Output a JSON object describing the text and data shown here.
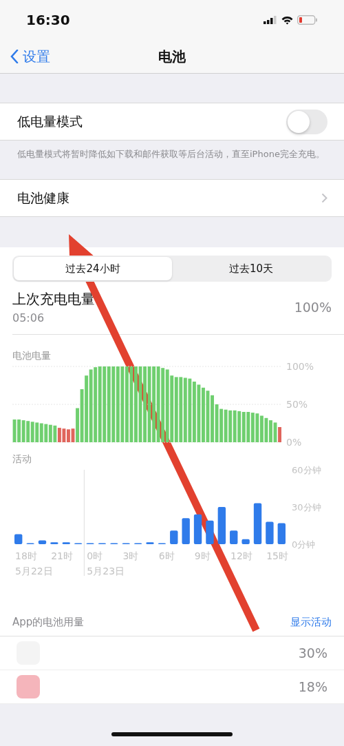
{
  "status_bar": {
    "time": "16:30"
  },
  "nav": {
    "back": "设置",
    "title": "电池"
  },
  "low_power": {
    "label": "低电量模式",
    "on": false,
    "footer": "低电量模式将暂时降低如下载和邮件获取等后台活动，直至iPhone完全充电。"
  },
  "battery_health": {
    "label": "电池健康"
  },
  "period_tabs": [
    {
      "label": "过去24小时",
      "selected": true
    },
    {
      "label": "过去10天",
      "selected": false
    }
  ],
  "last_charge": {
    "label": "上次充电电量",
    "time": "05:06",
    "value": "100%"
  },
  "battery_chart": {
    "chart_data": {
      "type": "bar",
      "title": "电池电量",
      "ylim": [
        0,
        100
      ],
      "yticks": [
        {
          "value": 0,
          "label": "0%"
        },
        {
          "value": 50,
          "label": "50%"
        },
        {
          "value": 100,
          "label": "100%"
        }
      ],
      "series": [
        {
          "color": "#6fcf6f",
          "values": [
            30,
            30,
            29,
            28,
            27,
            26,
            25,
            24,
            23,
            22,
            null,
            null,
            null,
            null,
            45,
            70,
            88,
            96,
            99,
            100,
            100,
            100,
            100,
            100,
            100,
            100,
            100,
            100,
            100,
            100,
            100,
            100,
            100,
            98,
            96,
            88,
            86,
            86,
            85,
            84,
            80,
            76,
            72,
            68,
            62,
            50,
            44,
            43,
            42,
            42,
            41,
            40,
            40,
            39,
            38,
            35,
            32,
            29,
            26,
            null
          ]
        },
        {
          "color": "#e0655c",
          "values": [
            null,
            null,
            null,
            null,
            null,
            null,
            null,
            null,
            null,
            null,
            19,
            18,
            17,
            18,
            null,
            null,
            null,
            null,
            null,
            null,
            null,
            null,
            null,
            null,
            null,
            null,
            null,
            null,
            null,
            null,
            null,
            null,
            null,
            null,
            null,
            null,
            null,
            null,
            null,
            null,
            null,
            null,
            null,
            null,
            null,
            null,
            null,
            null,
            null,
            null,
            null,
            null,
            null,
            null,
            null,
            null,
            null,
            null,
            null,
            20
          ]
        }
      ]
    }
  },
  "activity_chart": {
    "chart_data": {
      "type": "bar",
      "title": "活动",
      "ylim": [
        0,
        60
      ],
      "yticks": [
        {
          "value": 0,
          "label": "0分钟"
        },
        {
          "value": 30,
          "label": "30分钟"
        },
        {
          "value": 60,
          "label": "60分钟"
        }
      ],
      "categories": [
        "18时",
        null,
        null,
        "21时",
        null,
        null,
        "0时",
        null,
        null,
        "3时",
        null,
        null,
        "6时",
        null,
        null,
        "9时",
        null,
        null,
        "12时",
        null,
        null,
        "15时",
        null
      ],
      "series": [
        {
          "color": "#2f7bea",
          "values": [
            8,
            0.6,
            3,
            1.5,
            1.5,
            0.6,
            0,
            0,
            0,
            0.6,
            0,
            1.5,
            0,
            11,
            21,
            24,
            19,
            30,
            11,
            4,
            33,
            18,
            17
          ]
        }
      ]
    },
    "date_labels": [
      "5月22日",
      "5月23日"
    ]
  },
  "app_usage": {
    "header": "App的电池用量",
    "action": "显示活动",
    "apps": [
      {
        "percent": "30%"
      },
      {
        "percent": "18%"
      }
    ]
  }
}
